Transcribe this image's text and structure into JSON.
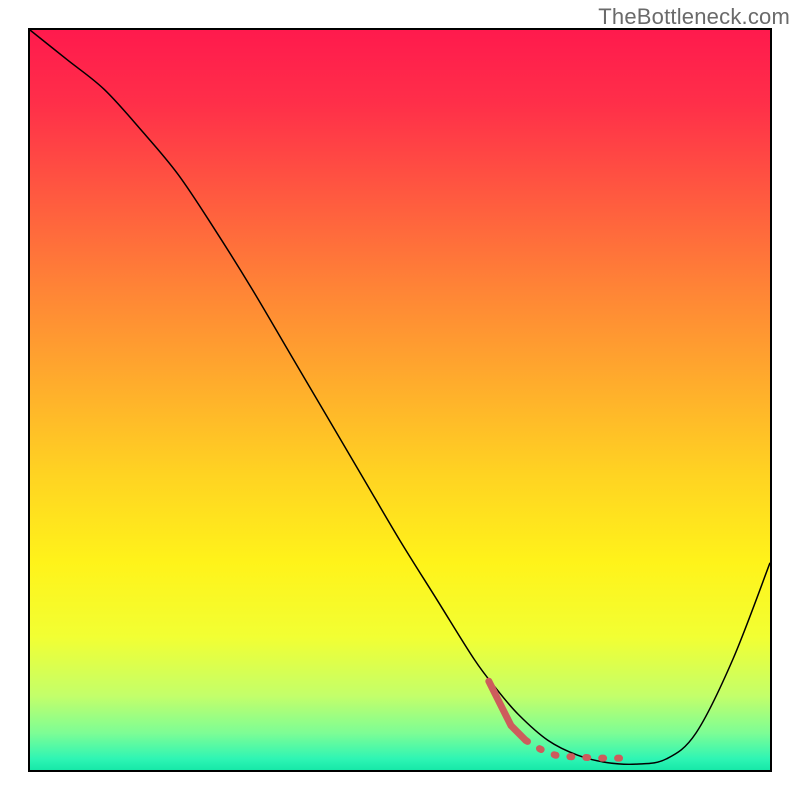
{
  "watermark": "TheBottleneck.com",
  "chart_data": {
    "type": "line",
    "title": "",
    "xlabel": "",
    "ylabel": "",
    "xlim": [
      0,
      100
    ],
    "ylim": [
      0,
      100
    ],
    "grid": false,
    "legend": false,
    "tick_labels_visible": false,
    "series": [
      {
        "name": "curve",
        "color": "#000000",
        "width": 1.5,
        "x": [
          0,
          5,
          10,
          15,
          20,
          25,
          30,
          35,
          40,
          45,
          50,
          55,
          60,
          63,
          66,
          70,
          74,
          78,
          82,
          86,
          90,
          95,
          100
        ],
        "y": [
          100,
          96,
          92,
          86.5,
          80.5,
          73,
          65,
          56.5,
          48,
          39.5,
          31,
          23,
          15,
          11,
          7.5,
          4,
          2,
          1,
          0.8,
          1.5,
          5,
          15,
          28
        ]
      },
      {
        "name": "highlight",
        "color": "#cd5c5c",
        "style": "dotted",
        "width": 7,
        "x": [
          62,
          63.5,
          65,
          67,
          69,
          71,
          73,
          75,
          77,
          80
        ],
        "y": [
          12,
          9,
          6,
          4,
          2.8,
          2,
          1.8,
          1.7,
          1.6,
          1.6
        ]
      }
    ],
    "background_gradient": {
      "type": "vertical",
      "stops": [
        {
          "pos": 0.0,
          "color": "#ff1a4d"
        },
        {
          "pos": 0.1,
          "color": "#ff2f49"
        },
        {
          "pos": 0.22,
          "color": "#ff5840"
        },
        {
          "pos": 0.35,
          "color": "#ff8436"
        },
        {
          "pos": 0.48,
          "color": "#ffad2c"
        },
        {
          "pos": 0.6,
          "color": "#ffd322"
        },
        {
          "pos": 0.72,
          "color": "#fff31a"
        },
        {
          "pos": 0.82,
          "color": "#f2ff33"
        },
        {
          "pos": 0.9,
          "color": "#c3ff6a"
        },
        {
          "pos": 0.95,
          "color": "#7dfd95"
        },
        {
          "pos": 0.985,
          "color": "#2ef5b4"
        },
        {
          "pos": 1.0,
          "color": "#17e8a8"
        }
      ]
    }
  }
}
